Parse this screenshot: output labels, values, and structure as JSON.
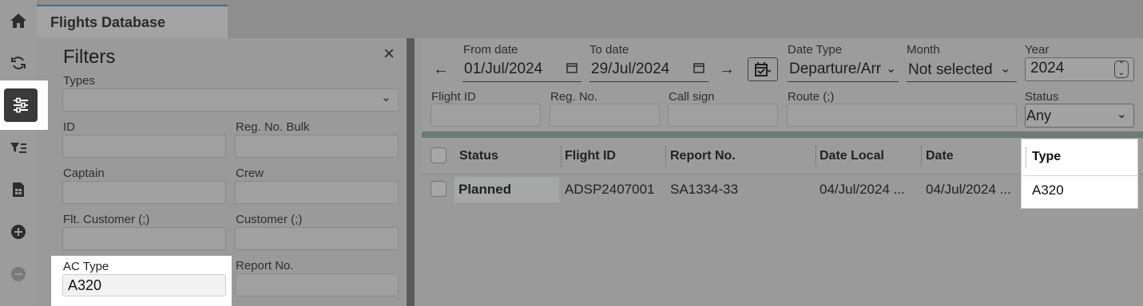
{
  "tab": {
    "title": "Flights Database"
  },
  "rail": {
    "icons": [
      "home-icon",
      "refresh-icon",
      "sliders-icon",
      "filter-list-icon",
      "spreadsheet-icon",
      "add-circle-icon",
      "remove-circle-icon"
    ]
  },
  "filters": {
    "title": "Filters",
    "close": "×",
    "types_label": "Types",
    "id_label": "ID",
    "reg_bulk_label": "Reg. No. Bulk",
    "captain_label": "Captain",
    "crew_label": "Crew",
    "flt_customer_label": "Flt. Customer (;)",
    "customer_label": "Customer (;)",
    "ac_type_label": "AC Type",
    "ac_type_value": "A320",
    "report_no_label": "Report No."
  },
  "top": {
    "back_arrow": "←",
    "forward_arrow": "→",
    "from_date_label": "From date",
    "from_date_value": "01/Jul/2024",
    "to_date_label": "To date",
    "to_date_value": "29/Jul/2024",
    "date_type_label": "Date Type",
    "date_type_value": "Departure/Arr",
    "month_label": "Month",
    "month_value": "Not selected",
    "year_label": "Year",
    "year_value": "2024",
    "flight_id_label": "Flight ID",
    "reg_no_label": "Reg. No.",
    "call_sign_label": "Call sign",
    "route_label": "Route (;)",
    "status_label": "Status",
    "status_value": "Any"
  },
  "grid": {
    "columns": [
      "Status",
      "Flight ID",
      "Report No.",
      "Date Local",
      "Date",
      "Type"
    ],
    "rows": [
      {
        "status": "Planned",
        "flight_id": "ADSP2407001",
        "report_no": "SA1334-33",
        "date_local": "04/Jul/2024 ...",
        "date": "04/Jul/2024 ...",
        "type": "A320"
      }
    ]
  }
}
